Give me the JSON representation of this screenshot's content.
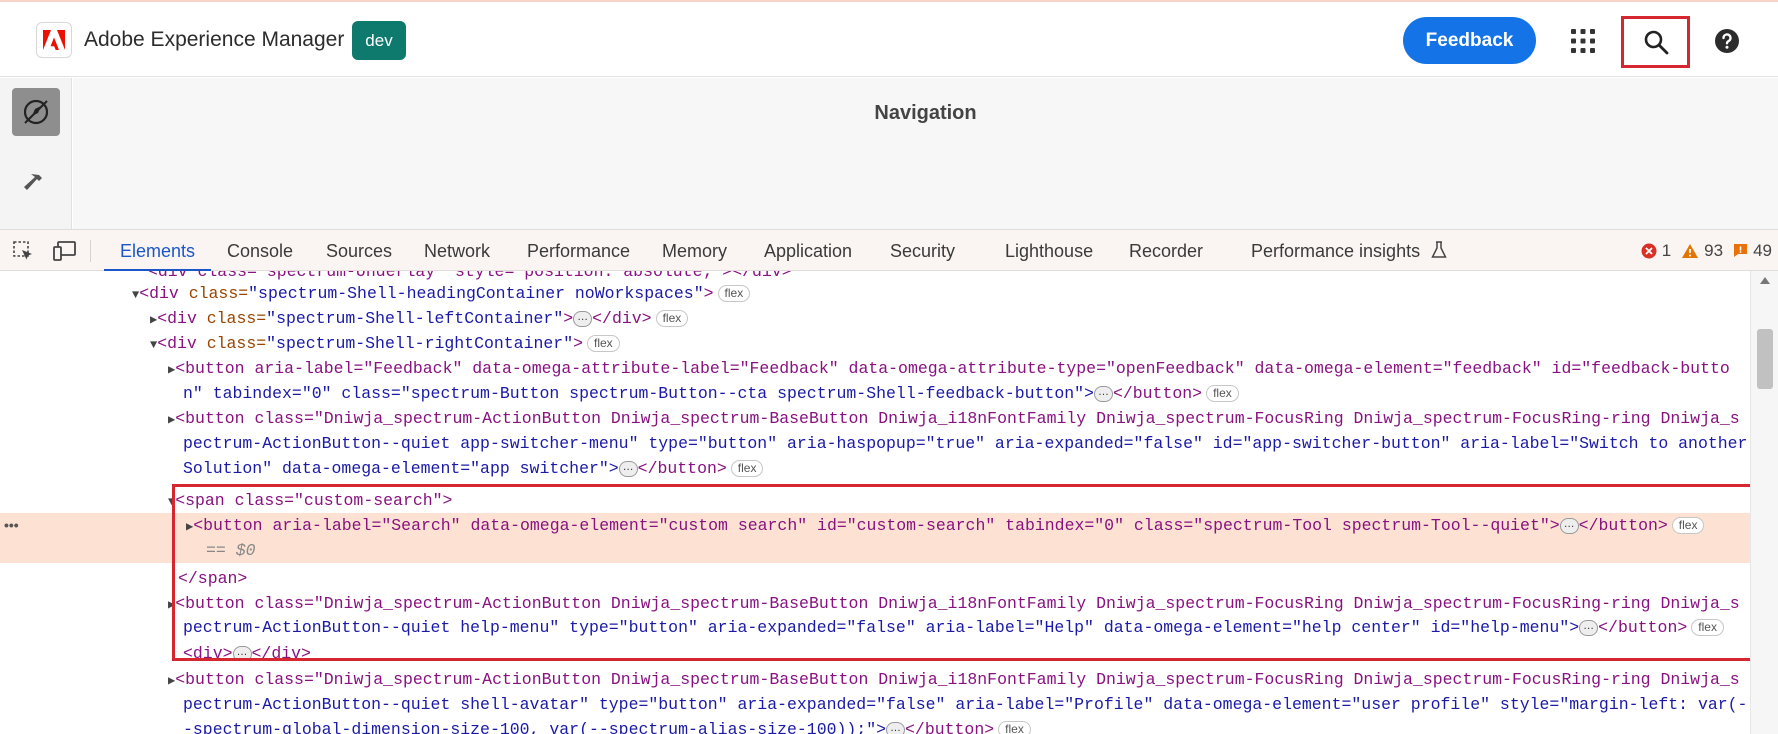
{
  "header": {
    "app_title": "Adobe Experience Manager",
    "env_badge": "dev",
    "feedback_label": "Feedback",
    "brand_color": "#1473e6",
    "env_color": "#0e7a6e"
  },
  "nav_panel": {
    "title": "Navigation"
  },
  "devtools": {
    "tabs": [
      "Elements",
      "Console",
      "Sources",
      "Network",
      "Performance",
      "Memory",
      "Application",
      "Security",
      "Lighthouse",
      "Recorder",
      "Performance insights"
    ],
    "active_tab": "Elements",
    "errors": "1",
    "warnings": "93",
    "issues": "49",
    "badge_flex": "flex",
    "selected_marker": "== $0",
    "lines": {
      "l0": "<div class=\"spectrum-Underlay\" style=\"position: absolute;\"></div>",
      "l1_tag": "<div",
      "l1_attr": "class=",
      "l1_val": "\"spectrum-Shell-headingContainer noWorkspaces\"",
      "l2_tag": "<div",
      "l2_attr": "class=",
      "l2_val": "\"spectrum-Shell-leftContainer\"",
      "l3_tag": "<div",
      "l3_attr": "class=",
      "l3_val": "\"spectrum-Shell-rightContainer\"",
      "l4a": "<button aria-label=\"Feedback\" data-omega-attribute-label=\"Feedback\" data-omega-attribute-type=\"openFeedback\" data-omega-element=\"feedback\" id=\"feedback-butto",
      "l4b": "n\" tabindex=\"0\" class=\"spectrum-Button spectrum-Button--cta spectrum-Shell-feedback-button\">",
      "l5a": "<button class=\"Dniwja_spectrum-ActionButton Dniwja_spectrum-BaseButton Dniwja_i18nFontFamily Dniwja_spectrum-FocusRing Dniwja_spectrum-FocusRing-ring Dniwja_s",
      "l5b": "pectrum-ActionButton--quiet app-switcher-menu\" type=\"button\" aria-haspopup=\"true\" aria-expanded=\"false\" id=\"app-switcher-button\" aria-label=\"Switch to another",
      "l5c": "Solution\" data-omega-element=\"app switcher\">",
      "l6": "<span class=\"custom-search\">",
      "l7": "<button aria-label=\"Search\" data-omega-element=\"custom search\" id=\"custom-search\" tabindex=\"0\" class=\"spectrum-Tool spectrum-Tool--quiet\">",
      "l8": "</span>",
      "l9a": "<button class=\"Dniwja_spectrum-ActionButton Dniwja_spectrum-BaseButton Dniwja_i18nFontFamily Dniwja_spectrum-FocusRing Dniwja_spectrum-FocusRing-ring Dniwja_s",
      "l9b": "pectrum-ActionButton--quiet help-menu\" type=\"button\" aria-expanded=\"false\" aria-label=\"Help\" data-omega-element=\"help center\" id=\"help-menu\">",
      "l10": "<div>",
      "l11a": "<button class=\"Dniwja_spectrum-ActionButton Dniwja_spectrum-BaseButton Dniwja_i18nFontFamily Dniwja_spectrum-FocusRing Dniwja_spectrum-FocusRing-ring Dniwja_s",
      "l11b": "pectrum-ActionButton--quiet shell-avatar\" type=\"button\" aria-expanded=\"false\" aria-label=\"Profile\" data-omega-element=\"user profile\" style=\"margin-left: var(-",
      "l11c": "-spectrum-global-dimension-size-100, var(--spectrum-alias-size-100));\">",
      "close_div": "</div>",
      "close_button": "</button>",
      "gt": ">"
    }
  }
}
